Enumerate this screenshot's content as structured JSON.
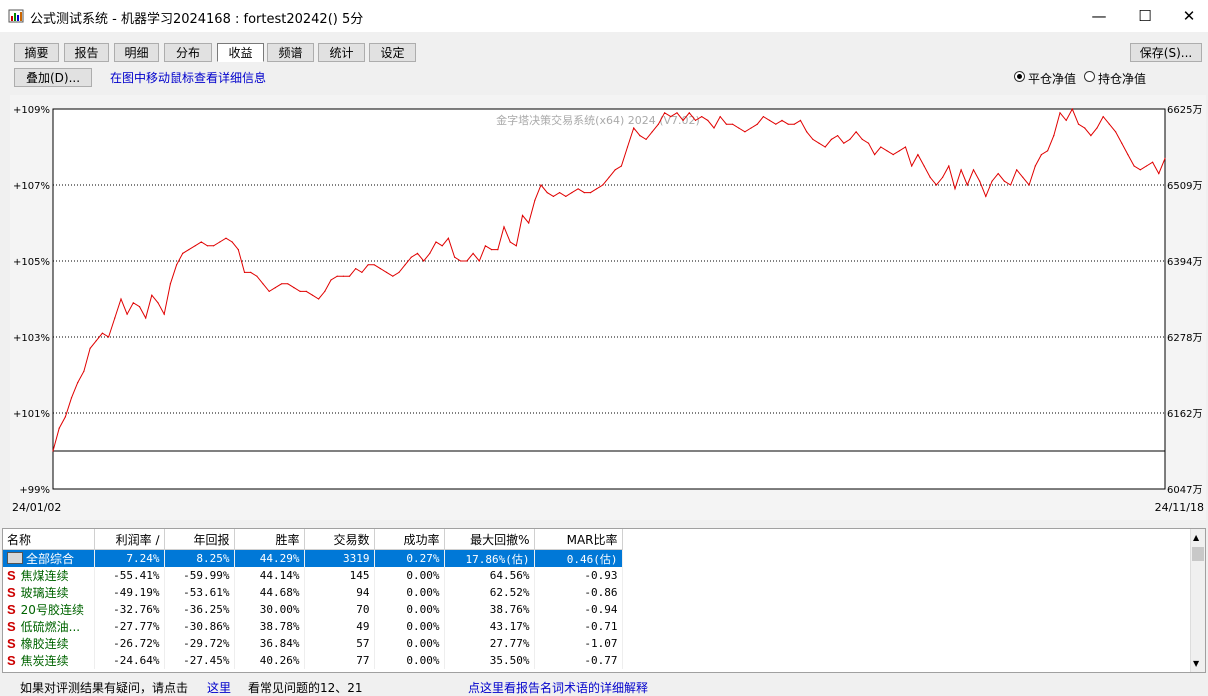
{
  "window": {
    "title": "公式测试系统 - 机器学习2024168 : fortest20242() 5分",
    "minimize": "—",
    "maximize": "☐",
    "close": "✕"
  },
  "tabs": [
    {
      "label": "摘要",
      "active": false
    },
    {
      "label": "报告",
      "active": false
    },
    {
      "label": "明细",
      "active": false
    },
    {
      "label": "分布",
      "active": false
    },
    {
      "label": "收益",
      "active": true
    },
    {
      "label": "频谱",
      "active": false
    },
    {
      "label": "统计",
      "active": false
    },
    {
      "label": "设定",
      "active": false
    }
  ],
  "toolbar": {
    "save_label": "保存(S)...",
    "overlay_label": "叠加(D)...",
    "hint": "在图中移动鼠标查看详细信息",
    "radio_flat": "平仓净值",
    "radio_hold": "持仓净值",
    "radio_selected": "flat"
  },
  "chart_data": {
    "type": "line",
    "watermark": "金字塔决策交易系统(x64) 2024 (V7.02)",
    "x_start_label": "24/01/02",
    "x_end_label": "24/11/18",
    "ylim_pct": [
      99,
      109
    ],
    "y_left_ticks": [
      "+109%",
      "+107%",
      "+105%",
      "+103%",
      "+101%",
      "+99%"
    ],
    "y_right_ticks": [
      "6625万",
      "6509万",
      "6394万",
      "6278万",
      "6162万",
      "6047万"
    ],
    "baseline_pct": 100,
    "line_color": "#e00000",
    "grid": "dotted",
    "series_pct": [
      100.0,
      100.6,
      100.9,
      101.4,
      101.8,
      102.1,
      102.7,
      102.9,
      103.1,
      103.0,
      103.5,
      104.0,
      103.6,
      103.9,
      103.8,
      103.5,
      104.1,
      103.9,
      103.6,
      104.4,
      104.9,
      105.2,
      105.3,
      105.4,
      105.5,
      105.4,
      105.4,
      105.5,
      105.6,
      105.5,
      105.3,
      104.7,
      104.7,
      104.6,
      104.4,
      104.2,
      104.3,
      104.4,
      104.4,
      104.3,
      104.2,
      104.2,
      104.1,
      104.0,
      104.2,
      104.5,
      104.6,
      104.6,
      104.6,
      104.8,
      104.7,
      104.9,
      104.9,
      104.8,
      104.7,
      104.6,
      104.7,
      104.9,
      105.1,
      105.2,
      105.0,
      105.2,
      105.5,
      105.4,
      105.6,
      105.1,
      105.0,
      105.0,
      105.2,
      105.0,
      105.4,
      105.3,
      105.3,
      105.9,
      105.5,
      105.4,
      106.2,
      106.0,
      106.6,
      107.0,
      106.8,
      106.7,
      106.8,
      106.7,
      106.8,
      106.9,
      106.8,
      106.8,
      106.9,
      107.0,
      107.2,
      107.4,
      107.5,
      108.0,
      108.5,
      108.3,
      108.2,
      108.4,
      108.6,
      108.9,
      108.8,
      108.9,
      108.7,
      108.9,
      108.7,
      108.8,
      108.7,
      108.5,
      108.8,
      108.6,
      108.6,
      108.5,
      108.4,
      108.5,
      108.6,
      108.8,
      108.7,
      108.6,
      108.7,
      108.6,
      108.6,
      108.7,
      108.4,
      108.2,
      108.1,
      108.0,
      108.2,
      108.3,
      108.1,
      108.2,
      108.4,
      108.2,
      108.1,
      107.8,
      108.0,
      107.9,
      107.8,
      107.9,
      108.0,
      107.5,
      107.8,
      107.5,
      107.2,
      107.0,
      107.2,
      107.5,
      106.9,
      107.4,
      107.0,
      107.4,
      107.1,
      106.7,
      107.1,
      107.3,
      107.1,
      107.0,
      107.4,
      107.2,
      107.0,
      107.5,
      107.8,
      107.9,
      108.3,
      108.9,
      108.7,
      109.0,
      108.6,
      108.5,
      108.3,
      108.5,
      108.8,
      108.6,
      108.4,
      108.1,
      107.8,
      107.5,
      107.4,
      107.5,
      107.6,
      107.3,
      107.7
    ]
  },
  "table": {
    "headers": [
      "名称",
      "利润率 ∕",
      "年回报",
      "胜率",
      "交易数",
      "成功率",
      "最大回撤%",
      "MAR比率"
    ],
    "rows": [
      {
        "name": "全部综合",
        "icon": "folder-icon",
        "cells": [
          "7.24%",
          "8.25%",
          "44.29%",
          "3319",
          "0.27%",
          "17.86%(估)",
          "0.46(估)"
        ],
        "selected": true
      },
      {
        "name": "焦煤连续",
        "icon": "s",
        "cells": [
          "-55.41%",
          "-59.99%",
          "44.14%",
          "145",
          "0.00%",
          "64.56%",
          "-0.93"
        ]
      },
      {
        "name": "玻璃连续",
        "icon": "s",
        "cells": [
          "-49.19%",
          "-53.61%",
          "44.68%",
          "94",
          "0.00%",
          "62.52%",
          "-0.86"
        ]
      },
      {
        "name": "20号胶连续",
        "icon": "s",
        "cells": [
          "-32.76%",
          "-36.25%",
          "30.00%",
          "70",
          "0.00%",
          "38.76%",
          "-0.94"
        ]
      },
      {
        "name": "低硫燃油...",
        "icon": "s",
        "cells": [
          "-27.77%",
          "-30.86%",
          "38.78%",
          "49",
          "0.00%",
          "43.17%",
          "-0.71"
        ]
      },
      {
        "name": "橡胶连续",
        "icon": "s",
        "cells": [
          "-26.72%",
          "-29.72%",
          "36.84%",
          "57",
          "0.00%",
          "27.77%",
          "-1.07"
        ]
      },
      {
        "name": "焦炭连续",
        "icon": "s",
        "cells": [
          "-24.64%",
          "-27.45%",
          "40.26%",
          "77",
          "0.00%",
          "35.50%",
          "-0.77"
        ]
      }
    ],
    "s_letter": "S"
  },
  "status": {
    "question": "如果对评测结果有疑问，请点击",
    "here_link": "这里",
    "faq": "看常见问题的12、21",
    "glossary_link": "点这里看报告名词术语的详细解释"
  }
}
